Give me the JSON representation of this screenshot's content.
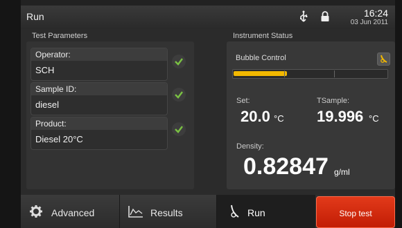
{
  "header": {
    "title": "Run",
    "time": "16:24",
    "date": "03 Jun 2011"
  },
  "test_parameters": {
    "title": "Test Parameters",
    "fields": [
      {
        "label": "Operator:",
        "value": "SCH"
      },
      {
        "label": "Sample ID:",
        "value": "diesel"
      },
      {
        "label": "Product:",
        "value": "Diesel 20°C"
      }
    ]
  },
  "instrument_status": {
    "title": "Instrument Status",
    "bubble_control": {
      "label": "Bubble Control",
      "level": 0.35
    },
    "set": {
      "label": "Set:",
      "value": "20.0",
      "unit": "°C"
    },
    "tsample": {
      "label": "TSample:",
      "value": "19.996",
      "unit": "°C"
    },
    "density": {
      "label": "Density:",
      "value": "0.82847",
      "unit": "g/ml"
    }
  },
  "tabs": [
    {
      "label": "Advanced",
      "icon": "gear-icon"
    },
    {
      "label": "Results",
      "icon": "chart-icon"
    },
    {
      "label": "Run",
      "icon": "run-icon",
      "active": true
    }
  ],
  "stop_button": {
    "label": "Stop test"
  },
  "colors": {
    "accent": "#f2b800",
    "stop": "#d42a0f",
    "check": "#7ac143"
  }
}
